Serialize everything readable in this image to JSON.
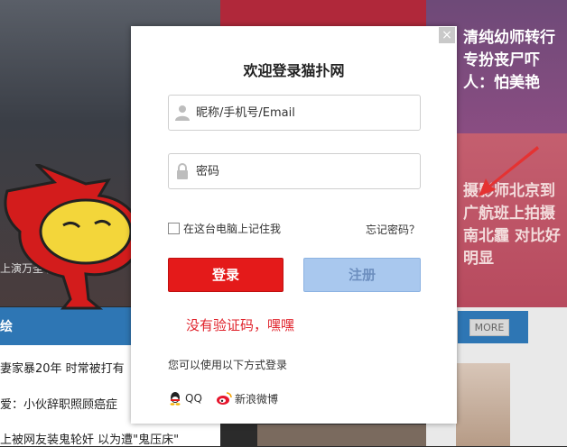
{
  "background": {
    "right_top_headline": "清纯幼师转行专扮丧尸吓人：怕美艳",
    "right_mid_headline": "摄影师北京到广航班上拍摄南北霾 对比好明显",
    "left_caption": "上演万圣节",
    "section_label": "绘",
    "more_label": "MORE",
    "list_items": [
      "妻家暴20年 时常被打有",
      "爱：小伙辞职照顾癌症",
      "上被网友装鬼轮奸 以为遭\"鬼压床\""
    ]
  },
  "modal": {
    "title": "欢迎登录猫扑网",
    "close_label": "×",
    "username_placeholder": "昵称/手机号/Email",
    "password_placeholder": "密码",
    "remember_label": "在这台电脑上记住我",
    "forgot_label": "忘记密码？",
    "login_label": "登录",
    "register_label": "注册",
    "notice": "没有验证码，嘿嘿",
    "alt_login_label": "您可以使用以下方式登录",
    "social": {
      "qq_label": "QQ",
      "weibo_label": "新浪微博"
    }
  },
  "colors": {
    "login_button": "#e41a1a",
    "register_button": "#a9c8ee",
    "notice_text": "#e0232c",
    "section_bar": "#2e76b4"
  },
  "icons": [
    "user-icon",
    "lock-icon",
    "qq-icon",
    "weibo-icon",
    "close-icon"
  ]
}
